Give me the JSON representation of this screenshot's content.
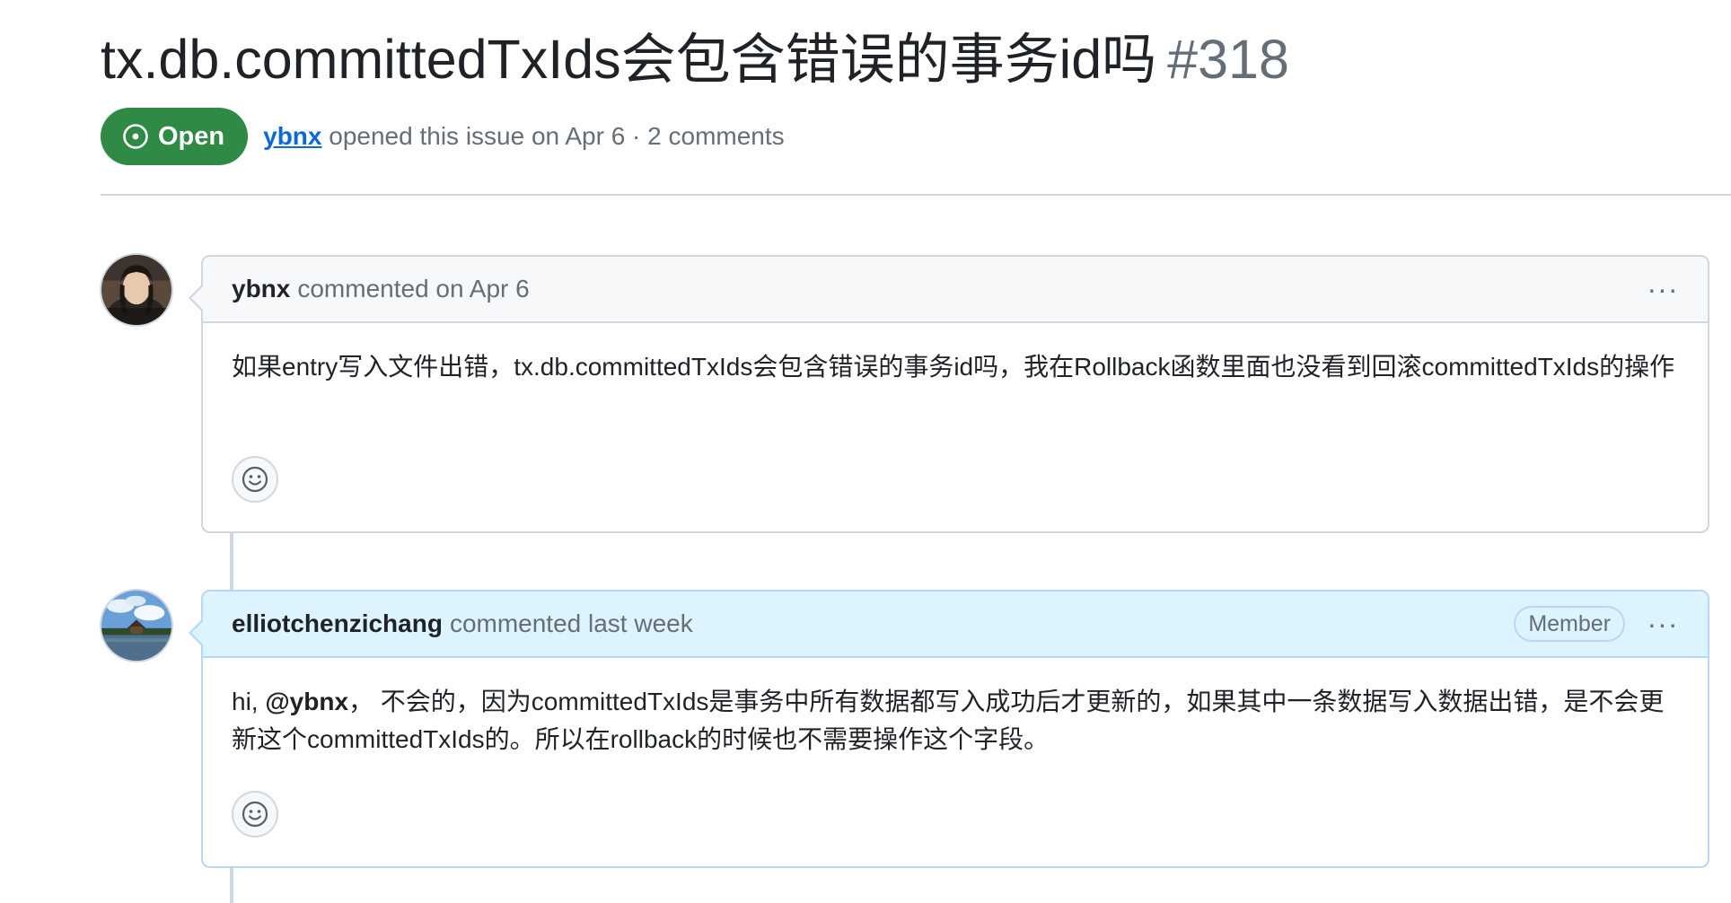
{
  "issue": {
    "title": "tx.db.committedTxIds会包含错误的事务id吗",
    "number": "#318",
    "state": "Open",
    "author": "ybnx",
    "meta_suffix": "opened this issue on Apr 6 · 2 comments"
  },
  "icons": {
    "state": "issue-opened-icon",
    "reaction": "smiley-icon",
    "menu": "kebab-horizontal-icon"
  },
  "colors": {
    "open_badge": "#2f8a46",
    "link": "#0969da",
    "member_header": "#ddf4ff",
    "border": "#d0d7de"
  },
  "comments": [
    {
      "author": "ybnx",
      "when": "commented on Apr 6",
      "role": "",
      "menu_label": "···",
      "body": "如果entry写入文件出错，tx.db.committedTxIds会包含错误的事务id吗，我在Rollback函数里面也没看到回滚committedTxIds的操作"
    },
    {
      "author": "elliotchenzichang",
      "when": "commented last week",
      "role": "Member",
      "menu_label": "···",
      "body_prefix": "hi, ",
      "body_mention": "@ybnx",
      "body_rest": "， 不会的，因为committedTxIds是事务中所有数据都写入成功后才更新的，如果其中一条数据写入数据出错，是不会更新这个committedTxIds的。所以在rollback的时候也不需要操作这个字段。"
    }
  ]
}
